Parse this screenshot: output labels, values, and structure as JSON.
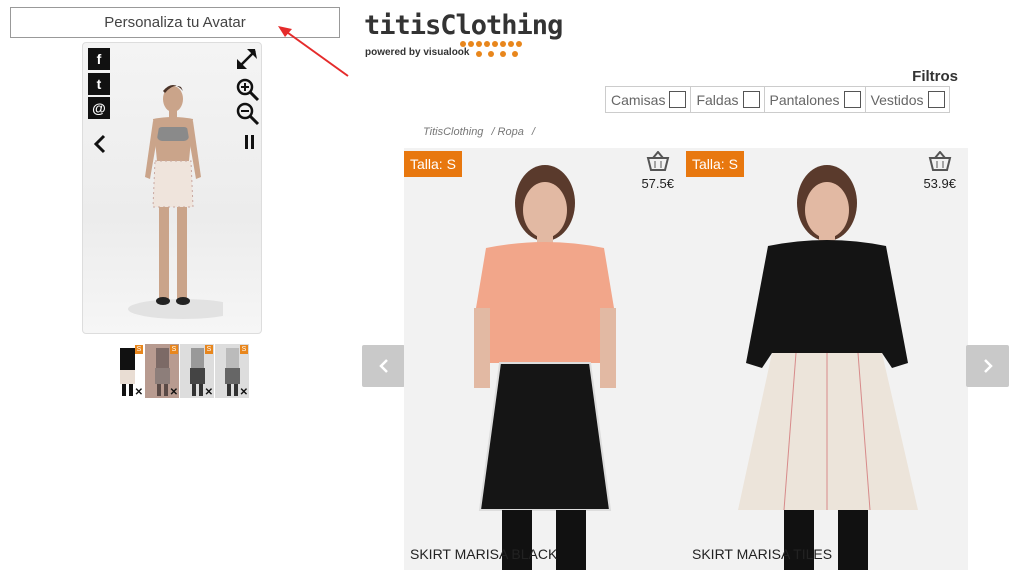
{
  "avatar": {
    "button_label": "Personaliza tu Avatar"
  },
  "social": [
    {
      "icon": "facebook-icon",
      "glyph": "f"
    },
    {
      "icon": "twitter-icon",
      "glyph": "t"
    },
    {
      "icon": "email-icon",
      "glyph": "@"
    }
  ],
  "viewer_controls": [
    "expand-icon",
    "zoom-in-icon",
    "zoom-out-icon",
    "pause-icon",
    "back-icon"
  ],
  "outfits": [
    {
      "size": "S",
      "remove": "✕"
    },
    {
      "size": "S",
      "remove": "✕"
    },
    {
      "size": "S",
      "remove": "✕"
    },
    {
      "size": "S",
      "remove": "✕"
    }
  ],
  "logo": {
    "title": "titisClothing",
    "tagline": "powered by visualook"
  },
  "filters": {
    "title": "Filtros",
    "items": [
      "Camisas",
      "Faldas",
      "Pantalones",
      "Vestidos"
    ]
  },
  "breadcrumb": [
    "TitisClothing",
    "/ Ropa",
    "/"
  ],
  "products": [
    {
      "size": "Talla: S",
      "price": "57.5€",
      "name": "SKIRT MARISA BLACK"
    },
    {
      "size": "Talla: S",
      "price": "53.9€",
      "name": "SKIRT MARISA TILES"
    }
  ],
  "colors": {
    "accent": "#e8780f",
    "nav": "#c9c9c9"
  }
}
